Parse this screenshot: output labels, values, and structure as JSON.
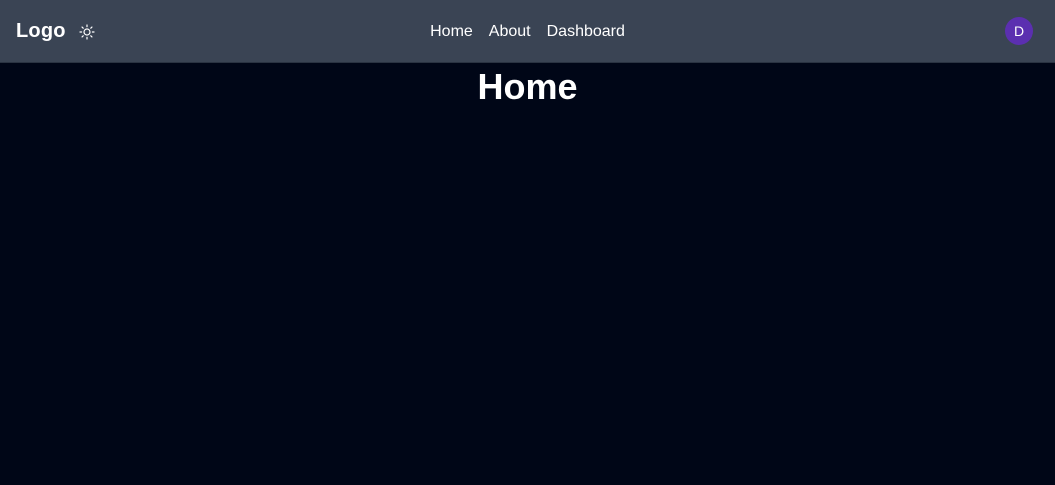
{
  "header": {
    "logo": "Logo",
    "theme_toggle_icon": "sun-icon",
    "nav": [
      {
        "label": "Home"
      },
      {
        "label": "About"
      },
      {
        "label": "Dashboard"
      }
    ],
    "avatar_initial": "D",
    "avatar_color": "#5b2fb0"
  },
  "main": {
    "title": "Home"
  },
  "colors": {
    "header_bg": "#3a4454",
    "page_bg": "#000617",
    "text": "#ffffff"
  }
}
